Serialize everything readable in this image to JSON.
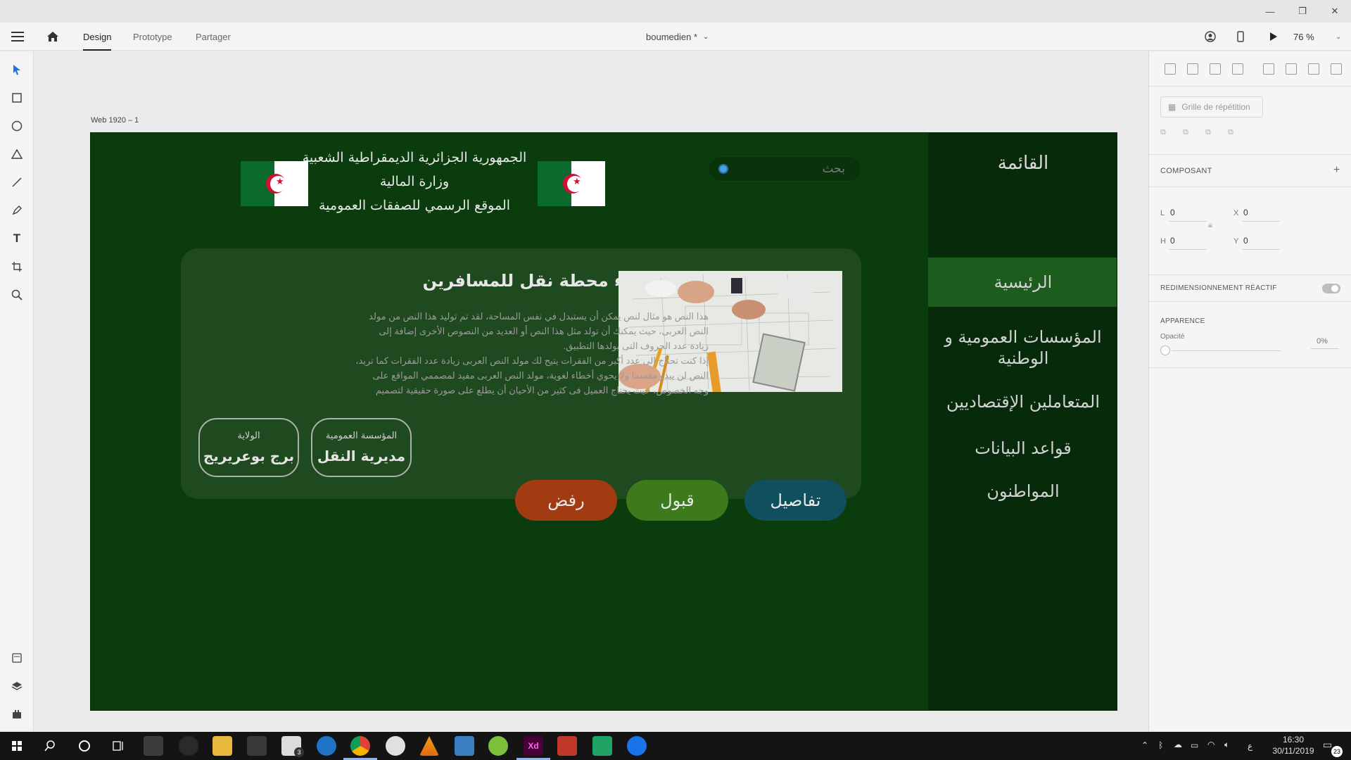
{
  "window": {
    "minimize": "—",
    "restore": "❐",
    "close": "✕"
  },
  "toolbar": {
    "tabs": [
      "Design",
      "Prototype",
      "Partager"
    ],
    "active_tab": "Design",
    "document_name": "boumedien *",
    "zoom": "76 %"
  },
  "artboard": {
    "label": "Web 1920 – 1",
    "header_lines": [
      "الجمهورية الجزائرية الديمقراطية الشعبية",
      "وزارة المالية",
      "الموقع الرسمي للصفقات العمومية"
    ],
    "search_placeholder": "بحث",
    "menu": {
      "title": "القائمة",
      "items": [
        {
          "label": "الرئيسية",
          "active": true
        },
        {
          "label": "المؤسسات العمومية و الوطنية",
          "active": false
        },
        {
          "label": "المتعاملين الإقتصاديين",
          "active": false
        },
        {
          "label": "قواعد البيانات",
          "active": false
        },
        {
          "label": "المواطنون",
          "active": false
        }
      ]
    },
    "card": {
      "title": "مشروع بناء محطة نقل للمسافرين",
      "body_lines": [
        "هذا النص هو مثال لنص يمكن أن يستبدل في نفس المساحة، لقد تم توليد هذا النص من مولد",
        "النص العربى، حيث يمكنك أن تولد مثل هذا النص أو العديد من النصوص الأخرى إضافة إلى",
        "زيادة عدد الحروف التى يولدها التطبيق.",
        "إذا كنت تحتاج إلى عدد أكبر من الفقرات يتيح لك مولد النص العربى زيادة عدد الفقرات كما تريد،",
        "النص لن يبدو مقسما ولا يحوي أخطاء لغوية، مولد النص العربى مفيد لمصممي المواقع على",
        "وجه الخصوص، حيث يحتاج العميل فى كثير من الأحيان أن يطلع على صورة حقيقية لتصميم"
      ],
      "tags": [
        {
          "label": "المؤسسة العمومية",
          "value": "مديرية النقل"
        },
        {
          "label": "الولاية",
          "value": "برج بوعريريج"
        }
      ]
    },
    "actions": {
      "reject": "رفض",
      "accept": "قبول",
      "details": "تفاصيل"
    }
  },
  "right_panel": {
    "repeat_grid": "Grille de répétition",
    "component_title": "COMPOSANT",
    "add_symbol": "+",
    "dims": {
      "L": "0",
      "H": "0",
      "X": "0",
      "Y": "0"
    },
    "responsive_resize": "REDIMENSIONNEMENT RÉACTIF",
    "appearance": "APPARENCE",
    "opacity_label": "Opacité",
    "opacity_value": "0%"
  },
  "taskbar": {
    "time": "16:30",
    "date": "30/11/2019",
    "notification_count": "23",
    "mail_badge": "3",
    "language": "ع"
  },
  "colors": {
    "artboard_bg": "#0a3c0e",
    "menu_bg": "#072b0a",
    "menu_active": "#1c5c1d",
    "card_bg": "#1f4a1f",
    "reject": "#a23a12",
    "accept": "#3c7a1c",
    "details": "#0f4f5e"
  }
}
